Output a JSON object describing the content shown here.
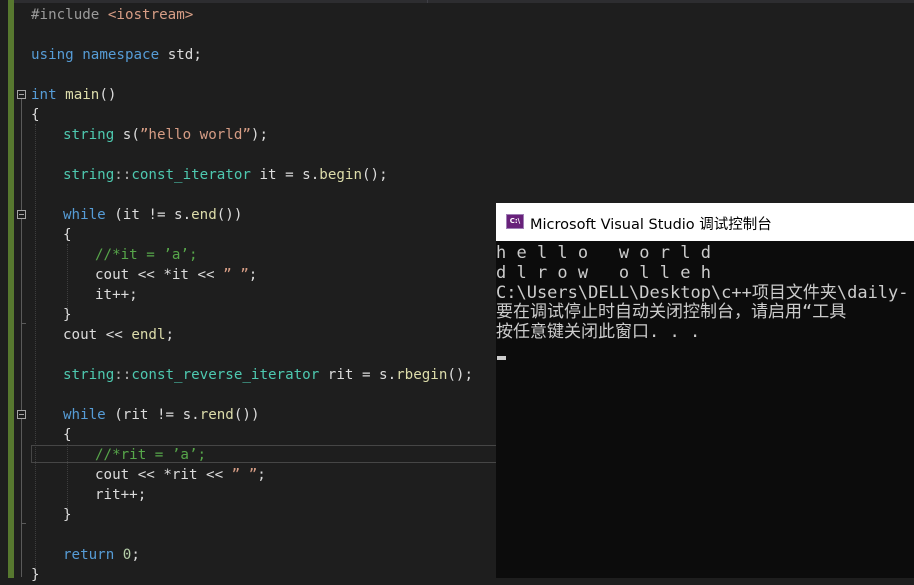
{
  "editor": {
    "lines": {
      "include_directive": "#include",
      "include_header": "<iostream>",
      "using_kw": "using",
      "namespace_kw": "namespace",
      "namespace_name": "std",
      "main_return_type": "int",
      "main_name": "main",
      "main_parens": "()",
      "open_brace_main": "{",
      "string_type": "string",
      "s_decl": " s(",
      "hello_literal": "”hello world”",
      "decl_end": ");",
      "iter_type_string": "string",
      "scope_op": "::",
      "const_iterator": "const_iterator",
      "it_assign_1": " it = s.",
      "begin_call": "begin",
      "it_assign_2": "();",
      "while1_kw": "while",
      "while1_cond_1": " (it != s.",
      "end_call": "end",
      "while1_cond_2": "())",
      "while1_open": "{",
      "while1_comment": "//*it = ’a’;",
      "cout1_a": "cout << *it << ",
      "cout1_str": "” ”",
      "cout1_end": ";",
      "it_inc": "it++;",
      "while1_close": "}",
      "cout_endl_a": "cout << ",
      "endl_name": "endl",
      "cout_endl_end": ";",
      "riter_type_string": "string",
      "scope_op2": "::",
      "const_reverse_iterator": "const_reverse_iterator",
      "rit_assign_1": " rit = s.",
      "rbegin_call": "rbegin",
      "rit_assign_2": "();",
      "while2_kw": "while",
      "while2_cond_1": " (rit != s.",
      "rend_call": "rend",
      "while2_cond_2": "())",
      "while2_open": "{",
      "while2_comment": "//*rit = ’a’;",
      "cout2_a": "cout << *rit << ",
      "cout2_str": "” ”",
      "cout2_end": ";",
      "rit_inc": "rit++;",
      "while2_close": "}",
      "return_kw": "return",
      "return_value": "0",
      "return_end": ";",
      "close_brace_main": "}"
    }
  },
  "console": {
    "title": "Microsoft Visual Studio 调试控制台",
    "icon": "visual-studio-console-icon",
    "output": [
      "h e l l o   w o r l d",
      "d l r o w   o l l e h",
      "C:\\Users\\DELL\\Desktop\\c++项目文件夹\\daily-",
      "要在调试停止时自动关闭控制台，请启用“工具",
      "按任意键关闭此窗口. . ."
    ]
  },
  "colors": {
    "editor_bg": "#1e1e1e",
    "keyword": "#569cd6",
    "type": "#4ec9b0",
    "string": "#d69d85",
    "comment": "#57a64a",
    "function": "#dcdcaa",
    "console_bg": "#0c0c0c",
    "change_bar": "#57782f"
  }
}
